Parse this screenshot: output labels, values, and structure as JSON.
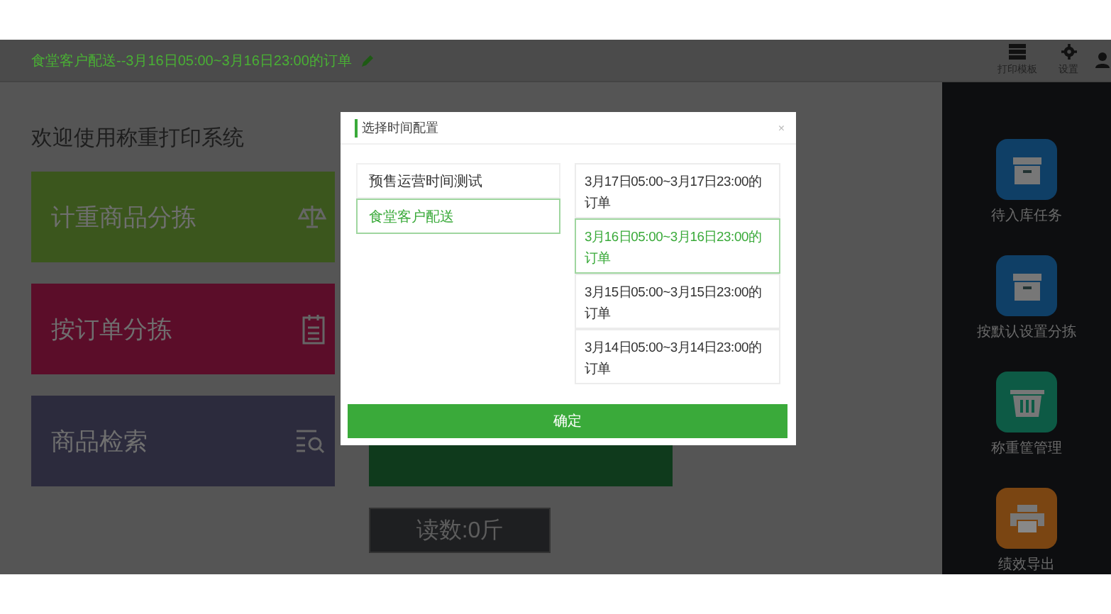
{
  "header": {
    "title": "食堂客户配送--3月16日05:00~3月16日23:00的订单",
    "actions": [
      {
        "label": "打印模板",
        "kind": "list"
      },
      {
        "label": "设置",
        "kind": "gear"
      },
      {
        "kind": "user"
      }
    ]
  },
  "welcome_title": "欢迎使用称重打印系统",
  "tiles": [
    {
      "label": "计重商品分拣",
      "color": "#3b561d",
      "kind": "scale"
    },
    {
      "label": "按订单分拣",
      "color": "#5b0d29",
      "kind": "notepad"
    },
    {
      "label": "商品检索",
      "color": "#2c2b3d",
      "kind": "search"
    }
  ],
  "reading": "读数:0斤",
  "sidebar": {
    "items": [
      {
        "label": "待入库任务",
        "color": "#0f3f66",
        "kind": "box"
      },
      {
        "label": "按默认设置分拣",
        "color": "#0f3f66",
        "kind": "box"
      },
      {
        "label": "称重筐管理",
        "color": "#0d5a45",
        "kind": "basket"
      },
      {
        "label": "绩效导出",
        "color": "#7a4512",
        "kind": "printer"
      }
    ]
  },
  "dialog": {
    "title": "选择时间配置",
    "close": "×",
    "groups": [
      {
        "label": "预售运营时间测试",
        "selected": false
      },
      {
        "label": "食堂客户配送",
        "selected": true
      }
    ],
    "slots": [
      {
        "label": "3月17日05:00~3月17日23:00的订单",
        "selected": false
      },
      {
        "label": "3月16日05:00~3月16日23:00的订单",
        "selected": true
      },
      {
        "label": "3月15日05:00~3月15日23:00的订单",
        "selected": false
      },
      {
        "label": "3月14日05:00~3月14日23:00的订单",
        "selected": false
      }
    ],
    "confirm": "确定"
  }
}
